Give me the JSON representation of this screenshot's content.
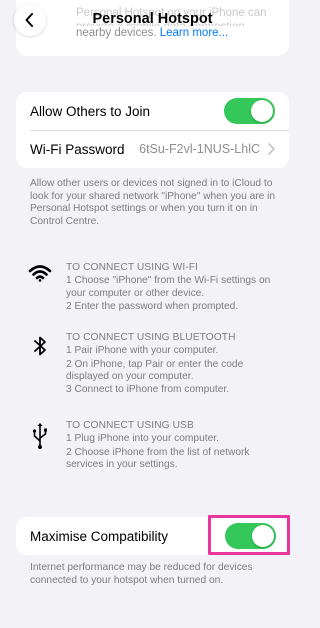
{
  "header": {
    "title": "Personal Hotspot",
    "top_text_faded": "Personal Hotspot on your iPhone can provide a mobile data connection",
    "top_text": "nearby devices.",
    "learn_more": "Learn more..."
  },
  "settings": {
    "allow_others": {
      "label": "Allow Others to Join",
      "on": true
    },
    "wifi_password": {
      "label": "Wi-Fi Password",
      "value": "6tSu-F2vl-1NUS-LhlC"
    }
  },
  "allow_footnote": "Allow other users or devices not signed in to iCloud to look for your shared network \"iPhone\" when you are in Personal Hotspot settings or when you turn it on in Control Centre.",
  "instructions": {
    "wifi": {
      "icon": "wifi-icon",
      "heading": "TO CONNECT USING WI-FI",
      "steps": [
        "1 Choose \"iPhone\" from the Wi-Fi settings on your computer or other device.",
        "2 Enter the password when prompted."
      ]
    },
    "bluetooth": {
      "icon": "bluetooth-icon",
      "heading": "TO CONNECT USING BLUETOOTH",
      "steps": [
        "1 Pair iPhone with your computer.",
        "2 On iPhone, tap Pair or enter the code displayed on your computer.",
        "3 Connect to iPhone from computer."
      ]
    },
    "usb": {
      "icon": "usb-icon",
      "heading": "TO CONNECT USING USB",
      "steps": [
        "1 Plug iPhone into your computer.",
        "2 Choose iPhone from the list of network services in your settings."
      ]
    }
  },
  "maximise": {
    "label": "Maximise Compatibility",
    "on": true
  },
  "maximise_footnote": "Internet performance may be reduced for devices connected to your hotspot when turned on.",
  "colors": {
    "toggle_on": "#34c759",
    "link": "#007aff",
    "highlight": "#e8369e",
    "background": "#f2f2f7"
  }
}
